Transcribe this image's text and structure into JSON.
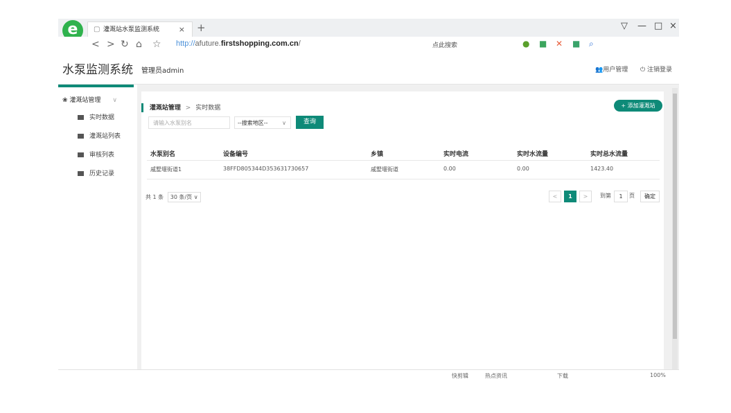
{
  "browser": {
    "tab_title": "灌溉站水泵监测系统",
    "tab_close": "×",
    "new_tab": "+",
    "window_controls": [
      "▽",
      "—",
      "□",
      "×"
    ],
    "nav_icons": [
      "<",
      ">",
      "↻",
      "⌂",
      "☆"
    ],
    "url_protocol": "http://",
    "url_prefix": "afuture.",
    "url_domain": "firstshopping.com.cn",
    "url_path": "/",
    "search_placeholder": "点此搜索",
    "toolbar_icons": [
      "shield-icon",
      "grid-icon",
      "tools-icon",
      "game-icon",
      "search-icon"
    ]
  },
  "app": {
    "title": "水泵监测系统",
    "user": "管理员admin",
    "user_mgmt": "用户管理",
    "logout": "注销登录"
  },
  "sidebar": {
    "group_label": "灌溉站管理",
    "items": [
      {
        "label": "实时数据"
      },
      {
        "label": "灌溉站列表"
      },
      {
        "label": "审核列表"
      },
      {
        "label": "历史记录"
      }
    ]
  },
  "breadcrumb": {
    "parent": "灌溉站管理",
    "separator": ">",
    "current": "实时数据"
  },
  "actions": {
    "add_button": "+ 添加灌溉站",
    "search_placeholder": "请输入水泵别名",
    "region_select": "--搜索地区--",
    "query_button": "查询"
  },
  "table": {
    "columns": [
      "水泵别名",
      "设备编号",
      "乡镇",
      "实时电流",
      "实时水流量",
      "实时总水流量"
    ],
    "rows": [
      [
        "戚墅堰街道1",
        "38FFD805344D353631730657",
        "戚墅堰街道",
        "0.00",
        "0.00",
        "1423.40"
      ]
    ]
  },
  "pagination": {
    "total": "共 1 条",
    "page_size": "30 条/页 ∨",
    "prev": "<",
    "current_page": "1",
    "next": ">",
    "goto_label": "到第",
    "goto_value": "1",
    "page_unit": "页",
    "confirm": "确定"
  },
  "statusbar": {
    "items": [
      "快剪辑",
      "热点资讯",
      "下载",
      "100%"
    ]
  },
  "colors": {
    "accent": "#0e8a78",
    "logo": "#2fb24d"
  }
}
